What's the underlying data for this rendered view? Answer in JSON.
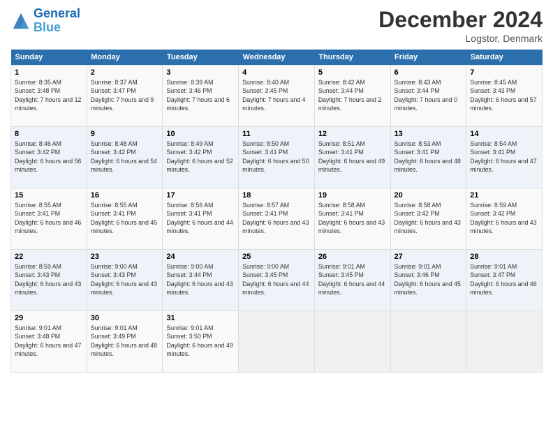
{
  "header": {
    "logo_line1": "General",
    "logo_line2": "Blue",
    "month": "December 2024",
    "location": "Logstor, Denmark"
  },
  "days_of_week": [
    "Sunday",
    "Monday",
    "Tuesday",
    "Wednesday",
    "Thursday",
    "Friday",
    "Saturday"
  ],
  "weeks": [
    [
      {
        "num": "1",
        "rise": "8:35 AM",
        "set": "3:48 PM",
        "daylight": "7 hours and 12 minutes."
      },
      {
        "num": "2",
        "rise": "8:37 AM",
        "set": "3:47 PM",
        "daylight": "7 hours and 9 minutes."
      },
      {
        "num": "3",
        "rise": "8:39 AM",
        "set": "3:46 PM",
        "daylight": "7 hours and 6 minutes."
      },
      {
        "num": "4",
        "rise": "8:40 AM",
        "set": "3:45 PM",
        "daylight": "7 hours and 4 minutes."
      },
      {
        "num": "5",
        "rise": "8:42 AM",
        "set": "3:44 PM",
        "daylight": "7 hours and 2 minutes."
      },
      {
        "num": "6",
        "rise": "8:43 AM",
        "set": "3:44 PM",
        "daylight": "7 hours and 0 minutes."
      },
      {
        "num": "7",
        "rise": "8:45 AM",
        "set": "3:43 PM",
        "daylight": "6 hours and 57 minutes."
      }
    ],
    [
      {
        "num": "8",
        "rise": "8:46 AM",
        "set": "3:42 PM",
        "daylight": "6 hours and 56 minutes."
      },
      {
        "num": "9",
        "rise": "8:48 AM",
        "set": "3:42 PM",
        "daylight": "6 hours and 54 minutes."
      },
      {
        "num": "10",
        "rise": "8:49 AM",
        "set": "3:42 PM",
        "daylight": "6 hours and 52 minutes."
      },
      {
        "num": "11",
        "rise": "8:50 AM",
        "set": "3:41 PM",
        "daylight": "6 hours and 50 minutes."
      },
      {
        "num": "12",
        "rise": "8:51 AM",
        "set": "3:41 PM",
        "daylight": "6 hours and 49 minutes."
      },
      {
        "num": "13",
        "rise": "8:53 AM",
        "set": "3:41 PM",
        "daylight": "6 hours and 48 minutes."
      },
      {
        "num": "14",
        "rise": "8:54 AM",
        "set": "3:41 PM",
        "daylight": "6 hours and 47 minutes."
      }
    ],
    [
      {
        "num": "15",
        "rise": "8:55 AM",
        "set": "3:41 PM",
        "daylight": "6 hours and 46 minutes."
      },
      {
        "num": "16",
        "rise": "8:55 AM",
        "set": "3:41 PM",
        "daylight": "6 hours and 45 minutes."
      },
      {
        "num": "17",
        "rise": "8:56 AM",
        "set": "3:41 PM",
        "daylight": "6 hours and 44 minutes."
      },
      {
        "num": "18",
        "rise": "8:57 AM",
        "set": "3:41 PM",
        "daylight": "6 hours and 43 minutes."
      },
      {
        "num": "19",
        "rise": "8:58 AM",
        "set": "3:41 PM",
        "daylight": "6 hours and 43 minutes."
      },
      {
        "num": "20",
        "rise": "8:58 AM",
        "set": "3:42 PM",
        "daylight": "6 hours and 43 minutes."
      },
      {
        "num": "21",
        "rise": "8:59 AM",
        "set": "3:42 PM",
        "daylight": "6 hours and 43 minutes."
      }
    ],
    [
      {
        "num": "22",
        "rise": "8:59 AM",
        "set": "3:43 PM",
        "daylight": "6 hours and 43 minutes."
      },
      {
        "num": "23",
        "rise": "9:00 AM",
        "set": "3:43 PM",
        "daylight": "6 hours and 43 minutes."
      },
      {
        "num": "24",
        "rise": "9:00 AM",
        "set": "3:44 PM",
        "daylight": "6 hours and 43 minutes."
      },
      {
        "num": "25",
        "rise": "9:00 AM",
        "set": "3:45 PM",
        "daylight": "6 hours and 44 minutes."
      },
      {
        "num": "26",
        "rise": "9:01 AM",
        "set": "3:45 PM",
        "daylight": "6 hours and 44 minutes."
      },
      {
        "num": "27",
        "rise": "9:01 AM",
        "set": "3:46 PM",
        "daylight": "6 hours and 45 minutes."
      },
      {
        "num": "28",
        "rise": "9:01 AM",
        "set": "3:47 PM",
        "daylight": "6 hours and 46 minutes."
      }
    ],
    [
      {
        "num": "29",
        "rise": "9:01 AM",
        "set": "3:48 PM",
        "daylight": "6 hours and 47 minutes."
      },
      {
        "num": "30",
        "rise": "9:01 AM",
        "set": "3:49 PM",
        "daylight": "6 hours and 48 minutes."
      },
      {
        "num": "31",
        "rise": "9:01 AM",
        "set": "3:50 PM",
        "daylight": "6 hours and 49 minutes."
      },
      null,
      null,
      null,
      null
    ]
  ]
}
